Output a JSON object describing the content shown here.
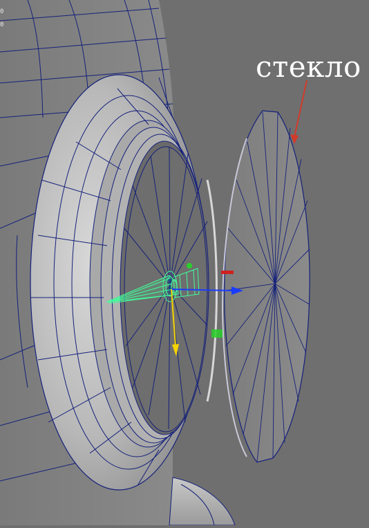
{
  "viewport": {
    "hud_lines": [
      "0",
      "0"
    ],
    "annotation_label": "стекло"
  },
  "colors": {
    "background": "#6f6f6f",
    "wireframe": "#14207a",
    "surface_light": "#c4c4c4",
    "surface_mid": "#9a9a9a",
    "surface_dark": "#5a5a5a",
    "selected": "#40ff9a",
    "arrow_red": "#d23a2a",
    "gizmo_blue": "#1a3cff",
    "gizmo_yellow": "#f5d400",
    "gizmo_red": "#d02020",
    "gizmo_green": "#2ad02a"
  }
}
